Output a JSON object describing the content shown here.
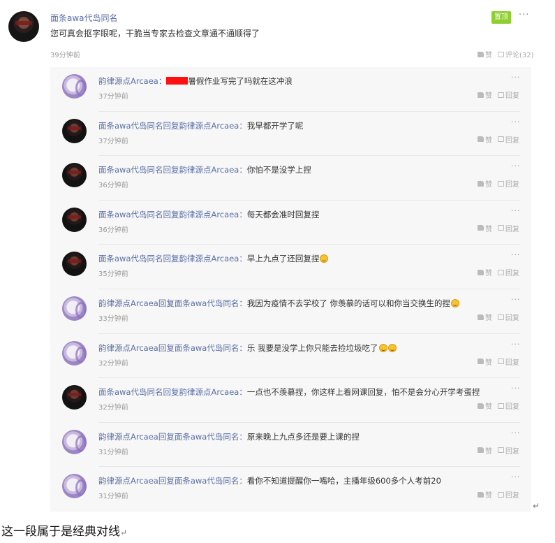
{
  "post": {
    "author": "面条awa代岛同名",
    "text": "您可真会抠字眼呢，干脆当专家去检查文章通不通顺得了",
    "time": "39分钟前",
    "pinned_label": "置顶",
    "more": "···",
    "like_label": "赞",
    "comment_label": "评论(32)"
  },
  "reply_actions": {
    "like": "赞",
    "reply": "回复",
    "more": "···"
  },
  "replies": [
    {
      "avatar": "dark-avatar",
      "author": "",
      "text_before": "",
      "redacted": false,
      "text": "",
      "emoji_count": 0,
      "time": ""
    },
    {
      "avatar": "light",
      "author": "韵律源点Arcaea：",
      "redacted": true,
      "text": "暑假作业写完了吗就在这冲浪",
      "emoji_count": 0,
      "time": "37分钟前"
    },
    {
      "avatar": "dark",
      "author": "面条awa代岛同名回复韵律源点Arcaea：",
      "redacted": false,
      "text": "我早都开学了呢",
      "emoji_count": 0,
      "time": "37分钟前"
    },
    {
      "avatar": "dark",
      "author": "面条awa代岛同名回复韵律源点Arcaea：",
      "redacted": false,
      "text": "你怕不是没学上捏",
      "emoji_count": 0,
      "time": "36分钟前"
    },
    {
      "avatar": "dark",
      "author": "面条awa代岛同名回复韵律源点Arcaea：",
      "redacted": false,
      "text": "每天都会准时回复捏",
      "emoji_count": 0,
      "time": "36分钟前"
    },
    {
      "avatar": "dark",
      "author": "面条awa代岛同名回复韵律源点Arcaea：",
      "redacted": false,
      "text": "早上九点了还回复捏",
      "emoji_count": 1,
      "time": "35分钟前"
    },
    {
      "avatar": "light",
      "author": "韵律源点Arcaea回复面条awa代岛同名：",
      "redacted": false,
      "text": "我因为疫情不去学校了 你羡慕的话可以和你当交换生的捏",
      "emoji_count": 1,
      "time": "33分钟前"
    },
    {
      "avatar": "light",
      "author": "韵律源点Arcaea回复面条awa代岛同名：",
      "redacted": false,
      "text": "乐 我要是没学上你只能去捡垃圾吃了",
      "emoji_count": 2,
      "time": "32分钟前"
    },
    {
      "avatar": "dark",
      "author": "面条awa代岛同名回复韵律源点Arcaea：",
      "redacted": false,
      "text": "一点也不羡慕捏，你这样上着网课回复，怕不是会分心开学考蛋捏",
      "emoji_count": 0,
      "time": "32分钟前"
    },
    {
      "avatar": "light",
      "author": "韵律源点Arcaea回复面条awa代岛同名：",
      "redacted": false,
      "text": "原来晚上九点多还是要上课的捏",
      "emoji_count": 0,
      "time": "31分钟前"
    },
    {
      "avatar": "light",
      "author": "韵律源点Arcaea回复面条awa代岛同名：",
      "redacted": false,
      "text": "看你不知道提醒你一嘴哈，主播年级600多个人考前20",
      "emoji_count": 0,
      "time": "31分钟前"
    }
  ],
  "document": {
    "caption": "这一段属于是经典对线",
    "paragraph_mark": "↵",
    "return_mark": "↵"
  }
}
